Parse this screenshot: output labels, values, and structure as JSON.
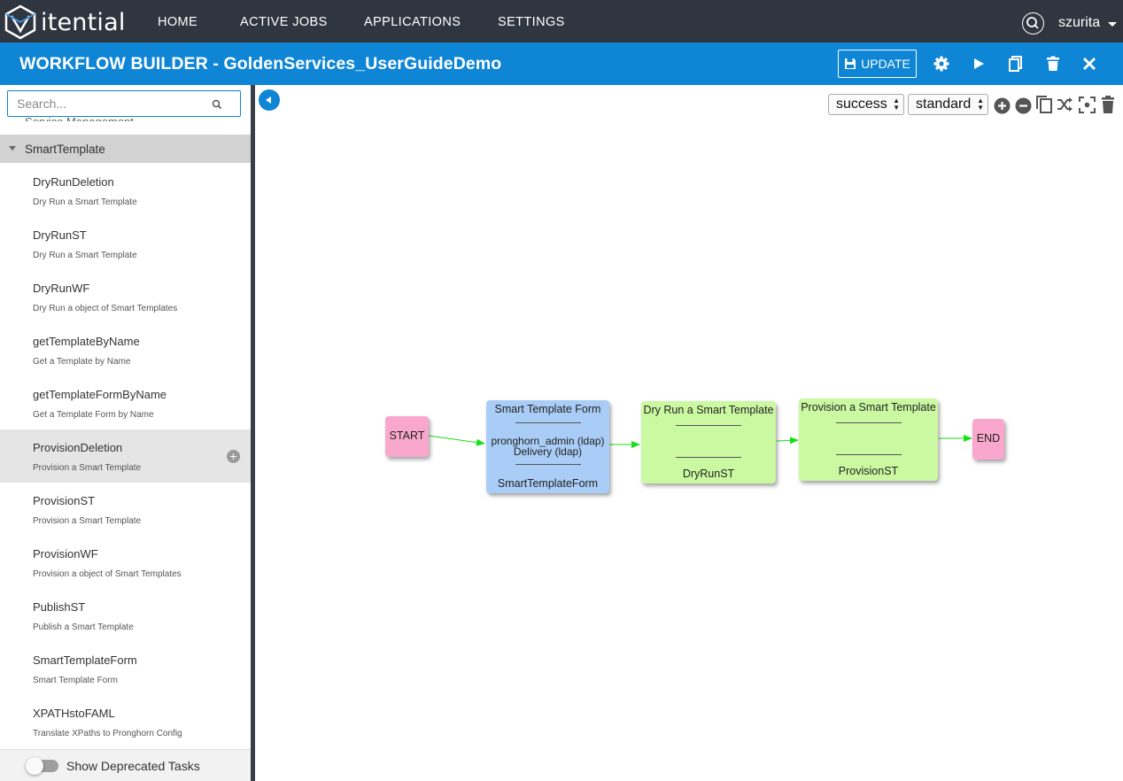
{
  "nav": {
    "brand": "itential",
    "items": [
      "HOME",
      "ACTIVE JOBS",
      "APPLICATIONS",
      "SETTINGS"
    ],
    "user": "szurita"
  },
  "header": {
    "title": "WORKFLOW BUILDER - GoldenServices_UserGuideDemo",
    "update_label": "UPDATE"
  },
  "sidebar": {
    "search_placeholder": "Search...",
    "cut_group": "Service Management",
    "group": "SmartTemplate",
    "tasks": [
      {
        "name": "DryRunDeletion",
        "desc": "Dry Run a Smart Template"
      },
      {
        "name": "DryRunST",
        "desc": "Dry Run a Smart Template"
      },
      {
        "name": "DryRunWF",
        "desc": "Dry Run a object of Smart Templates"
      },
      {
        "name": "getTemplateByName",
        "desc": "Get a Template by Name"
      },
      {
        "name": "getTemplateFormByName",
        "desc": "Get a Template Form by Name"
      },
      {
        "name": "ProvisionDeletion",
        "desc": "Provision a Smart Template"
      },
      {
        "name": "ProvisionST",
        "desc": "Provision a Smart Template"
      },
      {
        "name": "ProvisionWF",
        "desc": "Provision a object of Smart Templates"
      },
      {
        "name": "PublishST",
        "desc": "Publish a Smart Template"
      },
      {
        "name": "SmartTemplateForm",
        "desc": "Smart Template Form"
      },
      {
        "name": "XPATHstoFAML",
        "desc": "Translate XPaths to Pronghorn Config"
      }
    ],
    "deprecated_label": "Show Deprecated Tasks"
  },
  "canvas": {
    "transition_select": "success",
    "type_select": "standard",
    "nodes": {
      "start": "START",
      "form": {
        "title": "Smart Template Form",
        "line1": "pronghorn_admin (ldap)",
        "line2": "Delivery (ldap)",
        "name": "SmartTemplateForm"
      },
      "dryrun": {
        "title": "Dry Run a Smart Template",
        "name": "DryRunST"
      },
      "provision": {
        "title": "Provision a Smart Template",
        "name": "ProvisionST"
      },
      "end": "END"
    },
    "colors": {
      "start_end": "#f9a7cc",
      "manual_task": "#a9cdf7",
      "auto_task": "#cbf9a2",
      "transition": "#16e016"
    }
  }
}
